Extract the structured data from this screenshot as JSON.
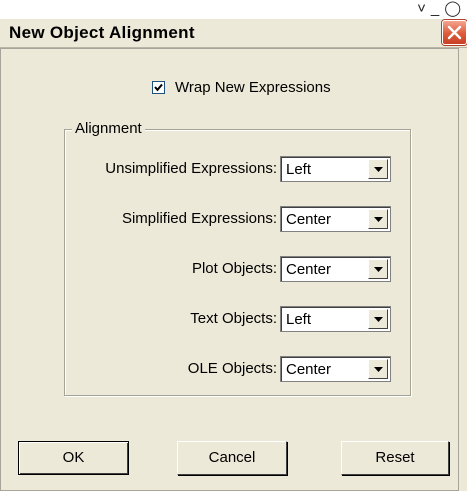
{
  "window": {
    "title": "New Object Alignment",
    "close_glyph": "✕"
  },
  "top_strip_icons": [
    "chevron-icon",
    "underline-icon",
    "circle-icon"
  ],
  "wrap_checkbox": {
    "label": "Wrap New Expressions",
    "checked": true
  },
  "alignment_group": {
    "legend": "Alignment",
    "rows": [
      {
        "label": "Unsimplified Expressions:",
        "value": "Left"
      },
      {
        "label": "Simplified Expressions:",
        "value": "Center"
      },
      {
        "label": "Plot Objects:",
        "value": "Center"
      },
      {
        "label": "Text Objects:",
        "value": "Left"
      },
      {
        "label": "OLE Objects:",
        "value": "Center"
      }
    ]
  },
  "buttons": {
    "ok": "OK",
    "cancel": "Cancel",
    "reset": "Reset"
  },
  "colors": {
    "dialog_bg": "#ece9d8",
    "close_button": "#dd5a3a"
  }
}
